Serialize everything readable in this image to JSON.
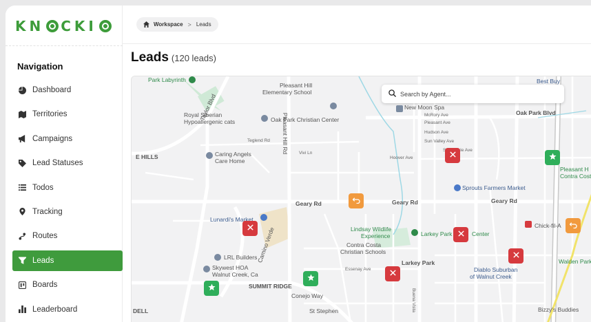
{
  "app": {
    "logo_text": "KNOCKIO"
  },
  "sidebar": {
    "title": "Navigation",
    "items": [
      {
        "label": "Dashboard",
        "icon": "pie-chart-icon",
        "active": false
      },
      {
        "label": "Territories",
        "icon": "map-icon",
        "active": false
      },
      {
        "label": "Campaigns",
        "icon": "megaphone-icon",
        "active": false
      },
      {
        "label": "Lead Statuses",
        "icon": "tag-icon",
        "active": false
      },
      {
        "label": "Todos",
        "icon": "list-icon",
        "active": false
      },
      {
        "label": "Tracking",
        "icon": "location-pin-icon",
        "active": false
      },
      {
        "label": "Routes",
        "icon": "route-icon",
        "active": false
      },
      {
        "label": "Leads",
        "icon": "leads-icon",
        "active": true
      },
      {
        "label": "Boards",
        "icon": "board-icon",
        "active": false
      },
      {
        "label": "Leaderboard",
        "icon": "bar-chart-icon",
        "active": false
      }
    ]
  },
  "breadcrumb": {
    "home_icon": "home-icon",
    "workspace": "Workspace",
    "separator": ">",
    "current": "Leads"
  },
  "page": {
    "title": "Leads",
    "count": "(120 leads)"
  },
  "map": {
    "search_placeholder": "Search by Agent...",
    "labels": {
      "park_labyrinth": "Park Labyrinth",
      "taylor_blvd_top": "Taylor Blvd",
      "taylor_blvd_bottom": "Taylor Blvd",
      "pleasant_hill_school_1": "Pleasant Hill",
      "pleasant_hill_school_2": "Elementary School",
      "royal_siberian_1": "Royal Siberian",
      "royal_siberian_2": "Hypoallergenic cats",
      "oak_park_christian": "Oak Park Christian Center",
      "new_moon_spa": "New Moon Spa",
      "mcrory_ave": "McRory Ave",
      "pleasant_ave": "Pleasant Ave",
      "hudson_ave": "Hudson Ave",
      "sun_valley_ave": "Sun Valley Ave",
      "hoover_ave": "Hoover Ave",
      "sunnyvale_ave": "Sunnyvale Ave",
      "oak_park_blvd": "Oak Park Blvd",
      "best_buy": "Best Buy",
      "pleasant_hill_right": "Pleasant H",
      "contra_costa_right": "Contra Costa C",
      "hills": "E HILLS",
      "caring_angels_1": "Caring Angels",
      "caring_angels_2": "Care Home",
      "tegland_rd": "Teglend Rd",
      "vivi_ln": "Vivi Ln",
      "pleasant_hill_rd": "Pleasant Hill Rd",
      "sprouts": "Sprouts Farmers Market",
      "geary_rd_left": "Geary Rd",
      "geary_rd_right": "Geary Rd",
      "geary_rd_far": "Geary Rd",
      "lunardis": "Lunardi's Market",
      "camino_verde": "Camino Verde",
      "lindsay_1": "Lindsay Wildlife",
      "lindsay_2": "Experience",
      "larkey_park_center": "Larkey Park",
      "center_suffix": "Center",
      "larkey_park": "Larkey Park",
      "chick_fil_a": "Chick-fil-A",
      "contra_costa_1": "Contra Costa",
      "contra_costa_2": "Christian Schools",
      "lrl_builders": "LRL Builders",
      "skywest_1": "Skywest HOA",
      "skywest_2": "Walnut Creek, Ca",
      "diablo_1": "Diablo Suburban",
      "diablo_2": "of Walnut Creek",
      "walden_park": "Walden Park",
      "summit_ridge": "SUMMIT RIDGE",
      "conejo_way": "Conejo Way",
      "st_stephen": "St Stephen",
      "dell": "DELL",
      "bizzys": "Bizzy's Buddies",
      "essenay_ave": "Essenay Ave",
      "buena_vista": "Buena Vista"
    },
    "pins": [
      {
        "color": "red",
        "type": "no-contact"
      },
      {
        "color": "red",
        "type": "no-contact"
      },
      {
        "color": "red",
        "type": "no-contact"
      },
      {
        "color": "red",
        "type": "no-contact"
      },
      {
        "color": "red",
        "type": "no-contact"
      },
      {
        "color": "green",
        "type": "star"
      },
      {
        "color": "green",
        "type": "star"
      },
      {
        "color": "green",
        "type": "star"
      },
      {
        "color": "orange",
        "type": "return"
      },
      {
        "color": "orange",
        "type": "return"
      }
    ]
  },
  "colors": {
    "accent": "#3f9b3d",
    "lead_red": "#d63a3e",
    "lead_green": "#2fae5a",
    "lead_orange": "#f19a3e"
  }
}
